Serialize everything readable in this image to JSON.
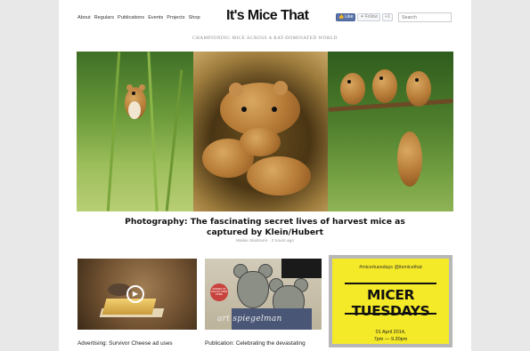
{
  "nav": {
    "items": [
      "About",
      "Regulars",
      "Publications",
      "Events",
      "Projects",
      "Shop"
    ]
  },
  "logo": "It's Mice That",
  "social": {
    "like": "Like",
    "follow": "Follow",
    "plus": "+1"
  },
  "search": {
    "placeholder": "Search"
  },
  "tagline": "CHAMPIONING MICE ACROSS A RAT-DOMINATED WORLD",
  "feature": {
    "headline": "Photography: The fascinating secret lives of harvest mice as captured by Klein/Hubert",
    "byline": "Maisie Skidmore · 2 hours ago"
  },
  "cards": {
    "advert_caption": "Advertising: Survivor Cheese ad uses",
    "publication_caption": "Publication: Celebrating the devastating",
    "maus_author": "art spiegelman",
    "maus_badge": "WINNER OF THE PULITZER PRIZE",
    "promo": {
      "hashtag": "#micertuesdays @itsmicethat",
      "title": "MICER TUESDAYS",
      "date": "01 April 2014,",
      "time": "7pm — 9.30pm"
    }
  },
  "colors": {
    "promo_yellow": "#f5ea27",
    "facebook_blue": "#5b74a8"
  }
}
